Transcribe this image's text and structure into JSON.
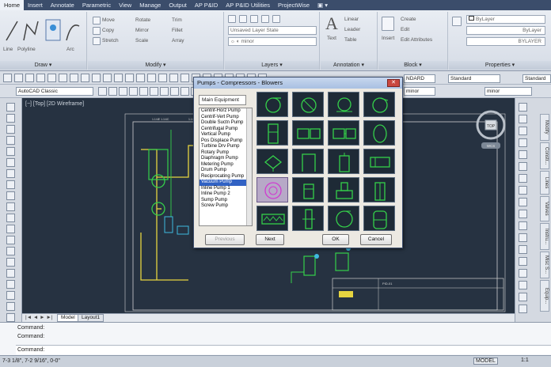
{
  "ribbon": {
    "tabs": [
      "Home",
      "Insert",
      "Annotate",
      "Parametric",
      "View",
      "Manage",
      "Output",
      "AP P&ID",
      "AP P&ID Utilities",
      "ProjectWise",
      "▣ ▾"
    ],
    "active_tab": 0,
    "panels": {
      "draw": "Draw ▾",
      "modify": "Modify ▾",
      "layers": "Layers ▾",
      "annotation": "Annotation ▾",
      "block": "Block ▾",
      "properties": "Properties ▾"
    },
    "draw_tools": [
      "Line",
      "Polyline",
      "Arc"
    ],
    "modify_tools": [
      "Move",
      "Rotate",
      "Trim",
      "Copy",
      "Mirror",
      "Fillet",
      "Stretch",
      "Scale",
      "Array"
    ],
    "layer_state": "Unsaved Layer State",
    "layer_current": "minor",
    "annotation_tools": [
      "Linear",
      "Leader",
      "Table",
      "Text"
    ],
    "block_tools": [
      "Create",
      "Edit",
      "Edit Attributes",
      "Insert"
    ],
    "properties_values": [
      "ByLayer",
      "ByLayer",
      "BYLAYER"
    ]
  },
  "toolbar": {
    "workspace": "AutoCAD Classic",
    "text_style": "Standard",
    "dim_style": "Standard",
    "standard_short": "NDARD",
    "layer_combo": "minor",
    "layer_combo2": "minor"
  },
  "viewport": {
    "label": "[−] [Top] [2D Wireframe]",
    "compass": "TOP",
    "wcs": "WCS",
    "drawing_labels": [
      "1.1/4E   1.1/4C",
      "1.1/4E   1.1/4C",
      "PID-01"
    ]
  },
  "dialog": {
    "title": "Pumps - Compressors - Blowers",
    "category": "Main Equipment",
    "items": [
      "Centrif-Horz Pump",
      "Centrif-Vert Pump",
      "Double Suctn Pump",
      "Centrifugal Pump",
      "Vertical Pump",
      "Pos Displace Pump",
      "Turbine Drv Pump",
      "Rotary Pump",
      "Diaphragm Pump",
      "Metering Pump",
      "Drum Pump",
      "Reciprocating Pump",
      "Vacuum Pump",
      "Inline Pump 1",
      "Inline Pump 2",
      "Sump Pump",
      "Screw Pump"
    ],
    "selected_item": 12,
    "buttons": {
      "previous": "Previous",
      "next": "Next",
      "ok": "OK",
      "cancel": "Cancel"
    }
  },
  "right_tabs": [
    "Modify",
    "Constr...",
    "Lines",
    "Valves",
    "Instru...",
    "Misc S...",
    "Equip..."
  ],
  "layout_tabs": {
    "model": "Model",
    "layout": "Layout1"
  },
  "command": {
    "lines": [
      "Command:",
      "Command:"
    ],
    "prompt": "Command:"
  },
  "status": {
    "coords": "7-3 1/8\",  7-2 9/16\", 0-0\"",
    "mode": "MODEL",
    "scale": "1:1"
  },
  "colors": {
    "drawing_bg": "#263241",
    "symbol_green": "#35d04a",
    "pipe_yellow": "#e6d440",
    "selected_list": "#3162c4"
  }
}
